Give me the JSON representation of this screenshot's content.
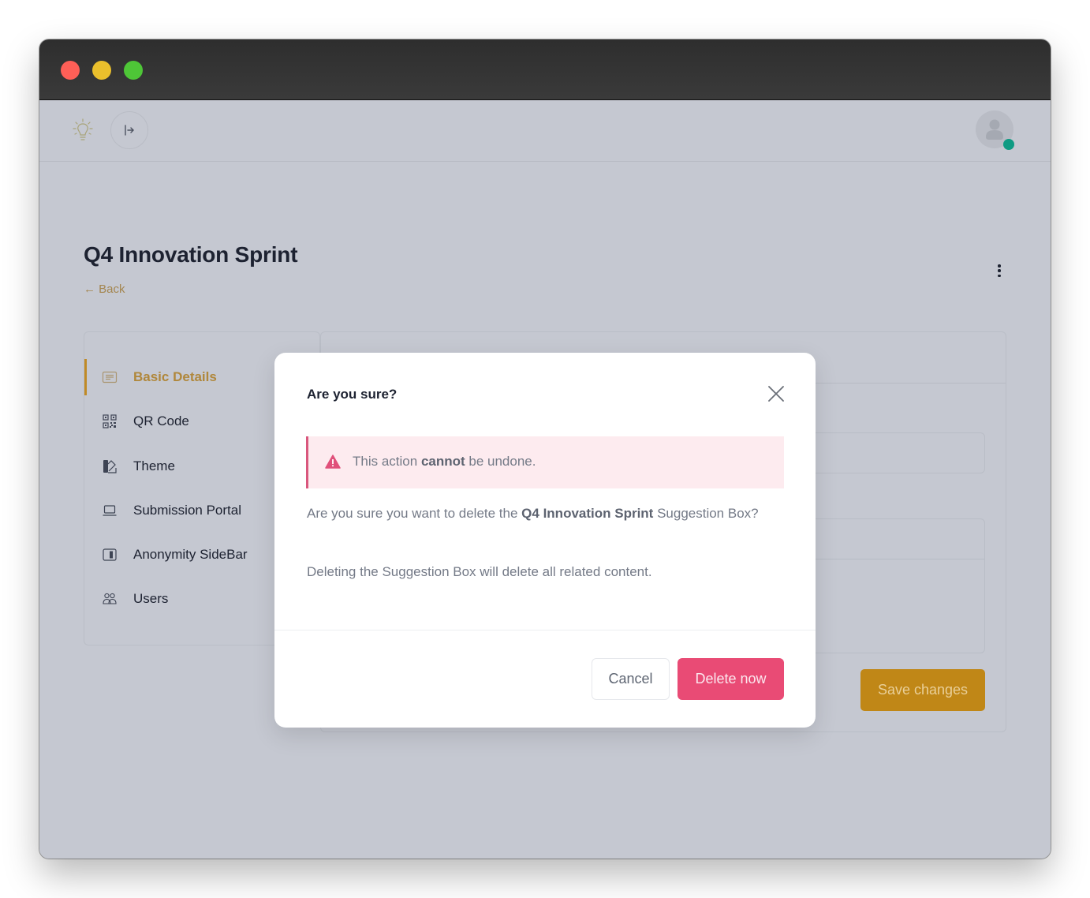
{
  "window": {
    "controls": [
      "close",
      "minimize",
      "maximize"
    ]
  },
  "topbar": {
    "logo_icon": "lightbulb-icon",
    "collapse_icon": "sidebar-expand-icon",
    "avatar_icon": "user-avatar-icon",
    "status": "online",
    "status_color": "#0f9b83"
  },
  "page": {
    "title": "Q4 Innovation Sprint",
    "back_label": "← Back",
    "more_icon": "vertical-ellipsis-icon"
  },
  "sidebar": {
    "items": [
      {
        "label": "Basic Details",
        "icon": "document-lines-icon",
        "active": true
      },
      {
        "label": "QR Code",
        "icon": "qr-code-icon",
        "active": false
      },
      {
        "label": "Theme",
        "icon": "swatch-icon",
        "active": false
      },
      {
        "label": "Submission Portal",
        "icon": "laptop-icon",
        "active": false
      },
      {
        "label": "Anonymity SideBar",
        "icon": "sidebar-panel-icon",
        "active": false
      },
      {
        "label": "Users",
        "icon": "users-icon",
        "active": false
      }
    ]
  },
  "panel": {
    "save_label": "Save changes"
  },
  "modal": {
    "title": "Are you sure?",
    "alert": {
      "prefix": "This action ",
      "emphasis": "cannot",
      "suffix": " be undone."
    },
    "body1": {
      "prefix": "Are you sure you want to delete the ",
      "emphasis": "Q4 Innovation Sprint",
      "suffix": " Suggestion Box?"
    },
    "body2": "Deleting the Suggestion Box will delete all related content.",
    "cancel_label": "Cancel",
    "delete_label": "Delete now"
  },
  "colors": {
    "accent": "#c08717",
    "danger": "#e94b75",
    "overlay": "#c5c8d1"
  }
}
